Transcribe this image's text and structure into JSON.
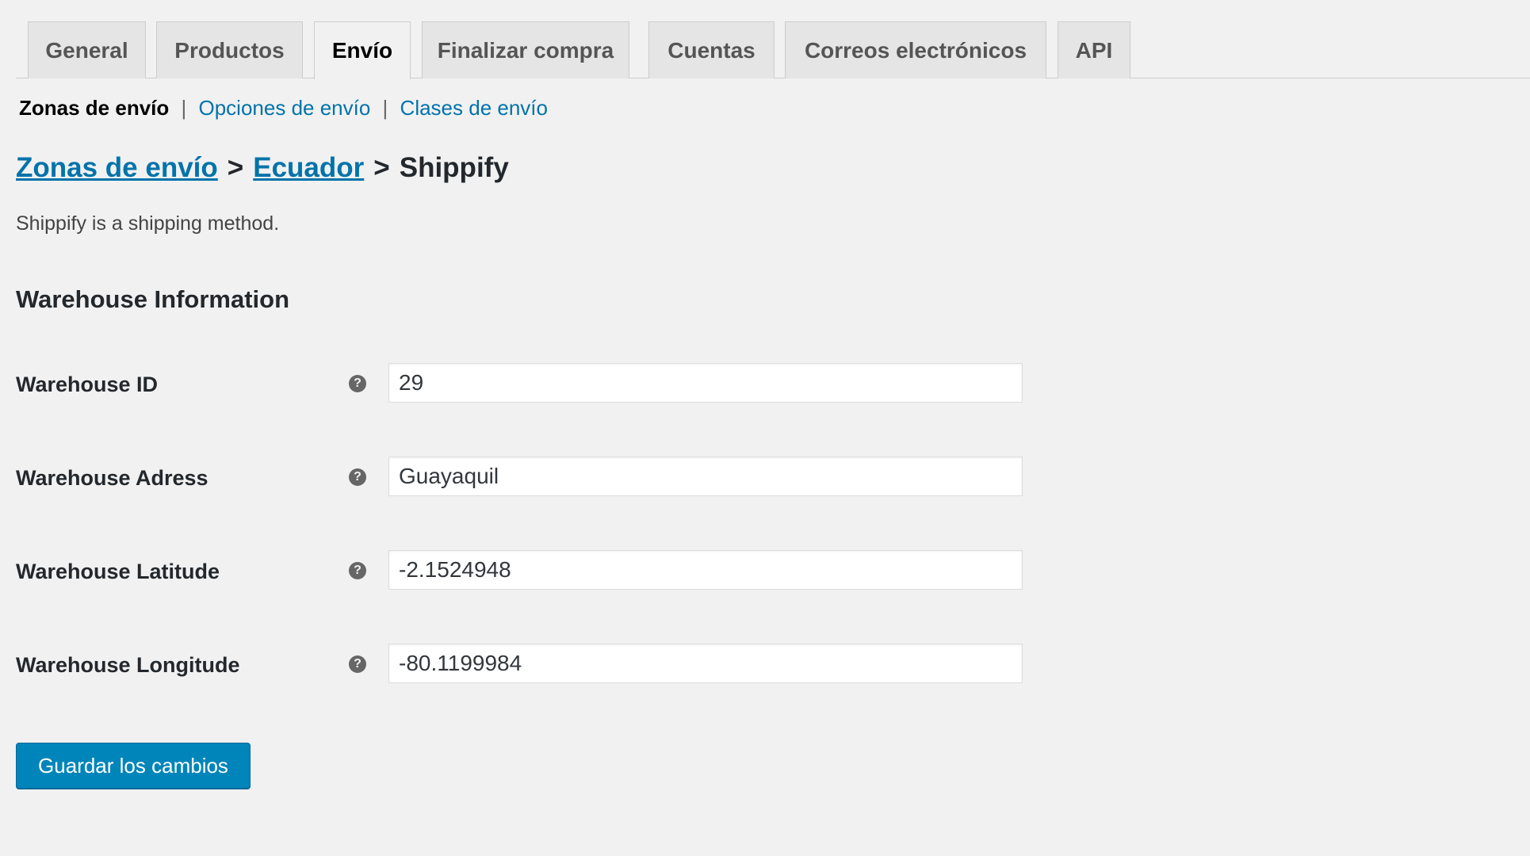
{
  "tabs": [
    {
      "label": "General",
      "active": false
    },
    {
      "label": "Productos",
      "active": false
    },
    {
      "label": "Envío",
      "active": true
    },
    {
      "label": "Finalizar compra",
      "active": false
    },
    {
      "label": "Cuentas",
      "active": false
    },
    {
      "label": "Correos electrónicos",
      "active": false
    },
    {
      "label": "API",
      "active": false
    }
  ],
  "subnav": {
    "current": "Zonas de envío",
    "separator": "|",
    "links": [
      "Opciones de envío",
      "Clases de envío"
    ]
  },
  "breadcrumb": {
    "root": "Zonas de envío",
    "zone": "Ecuador",
    "method": "Shippify",
    "separator": ">"
  },
  "description": "Shippify is a shipping method.",
  "section": {
    "title": "Warehouse Information"
  },
  "fields": [
    {
      "label": "Warehouse ID",
      "value": "29",
      "help_icon": "question-circle-icon"
    },
    {
      "label": "Warehouse Adress",
      "value": "Guayaquil",
      "help_icon": "question-circle-icon"
    },
    {
      "label": "Warehouse Latitude",
      "value": "-2.1524948",
      "help_icon": "question-circle-icon"
    },
    {
      "label": "Warehouse Longitude",
      "value": "-80.1199984",
      "help_icon": "question-circle-icon"
    }
  ],
  "help_glyph": "?",
  "save_button": {
    "label": "Guardar los cambios"
  },
  "colors": {
    "background": "#f1f1f1",
    "link": "#0073aa",
    "primary_button": "#0085ba",
    "text": "#23282d"
  }
}
